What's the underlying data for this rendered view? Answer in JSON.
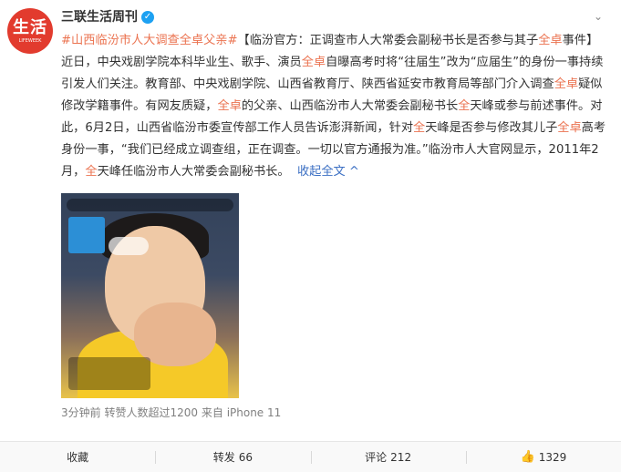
{
  "author": {
    "avatar_text": "生活",
    "avatar_sub": "LIFEWEEK",
    "name": "三联生活周刊",
    "verified_mark": "✓"
  },
  "post": {
    "topic": "#山西临汾市人大调查全卓父亲#",
    "body_1": "【临汾官方：正调查市人大常委会副秘书长是否参与其子",
    "name_1": "全卓",
    "body_2": "事件】近日，中央戏剧学院本科毕业生、歌手、演员",
    "name_2": "全卓",
    "body_3": "自曝高考时将“往届生”改为“应届生”的身份一事持续引发人们关注。教育部、中央戏剧学院、山西省教育厅、陕西省延安市教育局等部门介入调查",
    "name_3": "全卓",
    "body_4": "疑似修改学籍事件。有网友质疑，",
    "name_4": "全卓",
    "body_5": "的父亲、山西临汾市人大常委会副秘书长",
    "name_5": "全",
    "body_6": "天峰或参与前述事件。对此，6月2日，山西省临汾市委宣传部工作人员告诉澎湃新闻，针对",
    "name_6": "全",
    "body_7": "天峰是否参与修改其儿子",
    "name_7": "全卓",
    "body_8": "高考身份一事，“我们已经成立调查组，正在调查。一切以官方通报为准。”临汾市人大官网显示，2011年2月，",
    "name_8": "全",
    "body_9": "天峰任临汾市人大常委会副秘书长。",
    "collapse_link": "收起全文 ^"
  },
  "meta": {
    "time": "3分钟前",
    "repost_note": "转赞人数超过1200",
    "source_prefix": "来自",
    "source": "iPhone 11"
  },
  "actions": {
    "favorite": "收藏",
    "repost_label": "转发",
    "repost_count": "66",
    "comment_label": "评论",
    "comment_count": "212",
    "like_icon": "👍",
    "like_count": "1329"
  },
  "colors": {
    "highlight": "#eb7350",
    "avatar_bg": "#e23b2e"
  }
}
